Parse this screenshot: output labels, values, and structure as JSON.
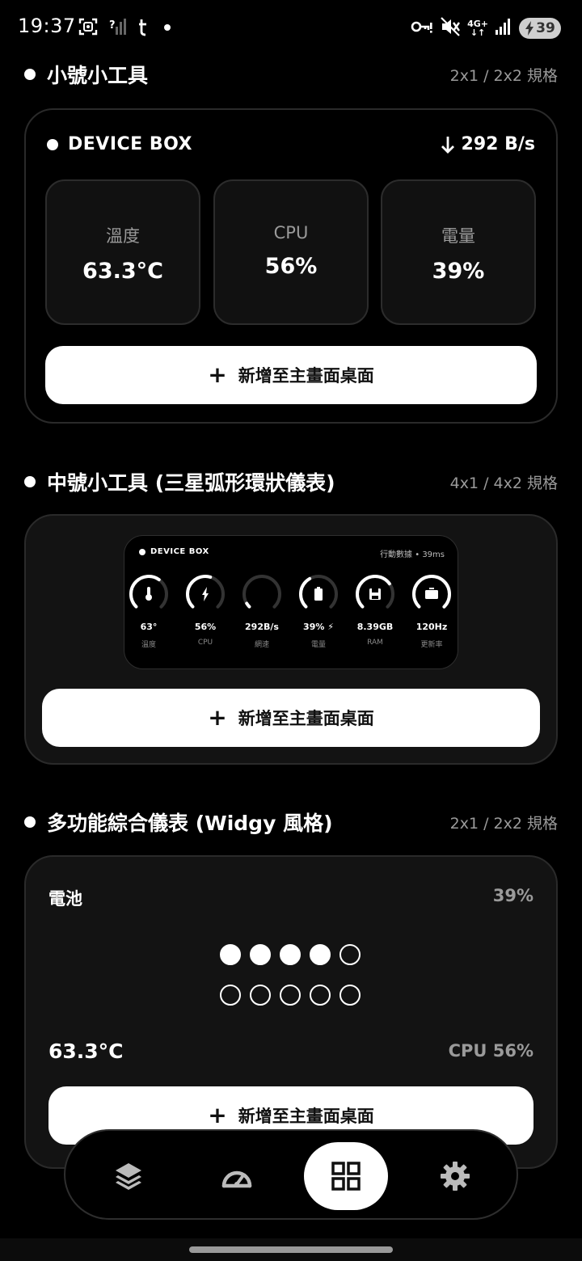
{
  "status_bar": {
    "time": "19:37",
    "left_icons": [
      "screenshot-icon",
      "signal-off-icon",
      "threads-icon",
      "dot-icon"
    ],
    "right_icons": [
      "vpn-key-icon",
      "mute-icon",
      "mobile-data-4g-icon",
      "signal-icon"
    ],
    "network": "4G+",
    "battery": "39"
  },
  "sections": [
    {
      "title": "小號小工具",
      "spec": "2x1 / 2x2 規格"
    },
    {
      "title": "中號小工具 (三星弧形環狀儀表)",
      "spec": "4x1 / 4x2 規格"
    },
    {
      "title": "多功能綜合儀表 (Widgy 風格)",
      "spec": "2x1 / 2x2 規格"
    }
  ],
  "small_widget": {
    "title": "DEVICE BOX",
    "net_speed": "292 B/s",
    "stats": [
      {
        "label": "溫度",
        "value": "63.3°C"
      },
      {
        "label": "CPU",
        "value": "56%"
      },
      {
        "label": "電量",
        "value": "39%"
      }
    ]
  },
  "medium_widget": {
    "title": "DEVICE BOX",
    "meta": "行動數據 • 39ms",
    "gauges": [
      {
        "value": "63°",
        "label": "溫度",
        "icon": "thermometer-icon",
        "level": 0.63
      },
      {
        "value": "56%",
        "label": "CPU",
        "icon": "bolt-icon",
        "level": 0.56
      },
      {
        "value": "292B/s",
        "label": "網速",
        "icon": "",
        "level": 0.05
      },
      {
        "value": "39% ⚡",
        "label": "電量",
        "icon": "battery-icon",
        "level": 0.39
      },
      {
        "value": "8.39GB",
        "label": "RAM",
        "icon": "save-icon",
        "level": 0.7
      },
      {
        "value": "120Hz",
        "label": "更新率",
        "icon": "display-icon",
        "level": 1.0
      }
    ]
  },
  "combo_widget": {
    "title": "電池",
    "percent": "39%",
    "dots_filled": 4,
    "dots_total": 10,
    "temp": "63.3°C",
    "cpu": "CPU 56%"
  },
  "buttons": {
    "add_to_home": "新增至主畫面桌面"
  },
  "bottom_nav": {
    "items": [
      "layers-icon",
      "speedometer-icon",
      "grid-icon",
      "gear-icon"
    ],
    "active": 2
  }
}
